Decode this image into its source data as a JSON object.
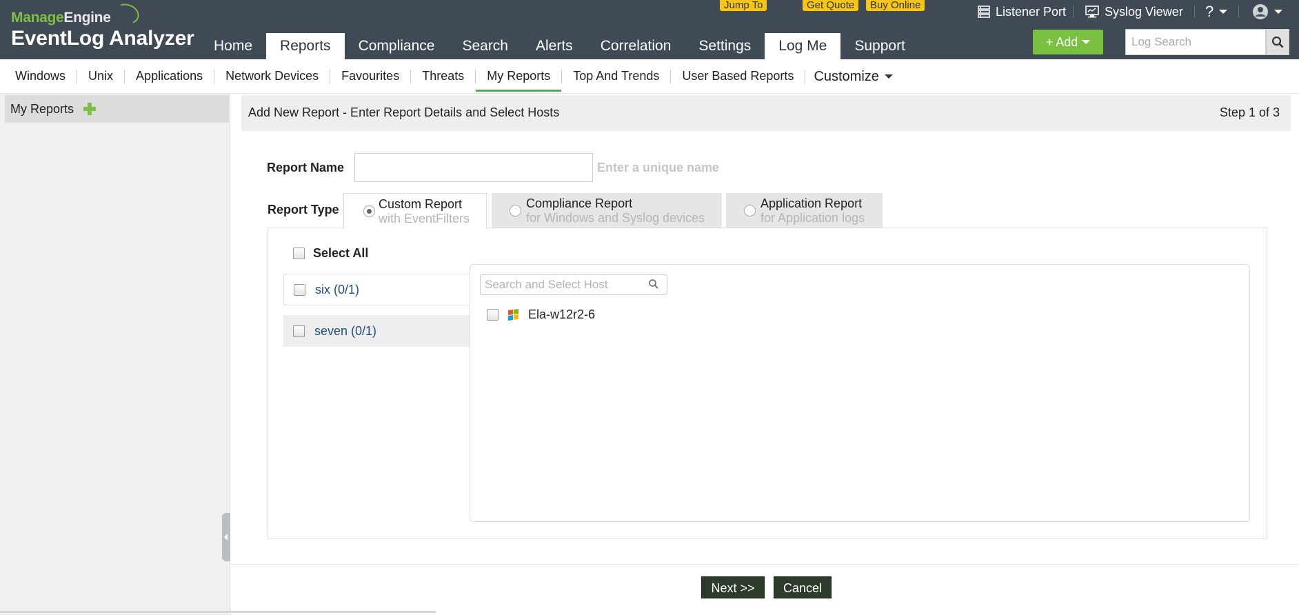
{
  "brand": {
    "top": "Manage",
    "top2": "Engine",
    "product": "EventLog Analyzer"
  },
  "main_nav": [
    "Home",
    "Reports",
    "Compliance",
    "Search",
    "Alerts",
    "Correlation",
    "Settings",
    "Log Me",
    "Support"
  ],
  "promos": {
    "jump_to": "Jump To",
    "get_quote": "Get Quote",
    "buy_online": "Buy Online"
  },
  "utilities": {
    "listener_port": "Listener Port",
    "syslog_viewer": "Syslog Viewer",
    "help": "?"
  },
  "add_button": "+ Add",
  "log_search": {
    "placeholder": "Log Search"
  },
  "sub_nav": [
    "Windows",
    "Unix",
    "Applications",
    "Network Devices",
    "Favourites",
    "Threats",
    "My Reports",
    "Top And Trends",
    "User Based Reports"
  ],
  "customize": "Customize",
  "left_panel": {
    "title": "My Reports"
  },
  "form": {
    "title": "Add New Report  - Enter Report Details and Select Hosts",
    "step": "Step 1 of 3",
    "report_name_label": "Report Name",
    "report_name_value": "",
    "report_name_hint": "Enter a unique name",
    "report_type_label": "Report Type",
    "report_types": [
      {
        "title": "Custom Report",
        "subtitle": "with EventFilters",
        "selected": true
      },
      {
        "title": "Compliance Report",
        "subtitle": "for Windows and Syslog devices",
        "selected": false
      },
      {
        "title": "Application Report",
        "subtitle": "for Application logs",
        "selected": false
      }
    ],
    "select_all": "Select All",
    "groups": [
      "six (0/1)",
      "seven (0/1)"
    ],
    "host_search_placeholder": "Search and Select Host",
    "hosts": [
      "Ela-w12r2-6"
    ],
    "next_button": "Next >>",
    "cancel_button": "Cancel"
  },
  "colors": {
    "header": "#3f4a54",
    "brand_green": "#7ac142",
    "promo": "#f5c518",
    "active_underline": "#4caf50",
    "button_dark": "#2d3a2c"
  },
  "icons": {
    "listener_port": "server-icon",
    "syslog_viewer": "monitor-icon",
    "account": "user-icon",
    "search": "magnifier-icon",
    "add": "plus-icon",
    "host": "windows-icon"
  }
}
